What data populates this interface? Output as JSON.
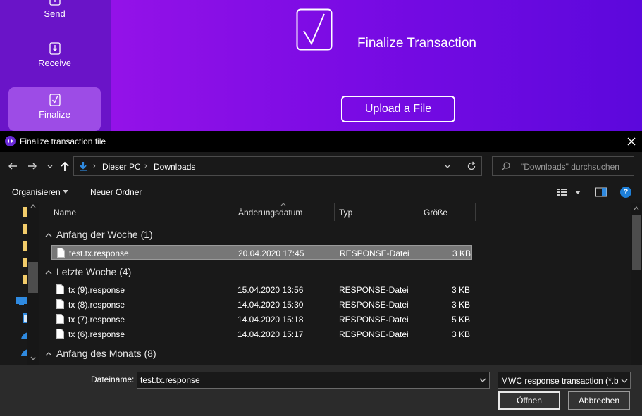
{
  "app": {
    "nav": [
      {
        "label": "Send",
        "icon": "upload-icon"
      },
      {
        "label": "Receive",
        "icon": "download-icon"
      },
      {
        "label": "Finalize",
        "icon": "checkbox-icon"
      }
    ],
    "main": {
      "title": "Finalize Transaction",
      "upload_label": "Upload a File"
    },
    "colors": {
      "sidebar": "#6a14c8",
      "main_start": "#9412e8",
      "main_end": "#5c08dc",
      "active_nav": "#9d4ce6"
    }
  },
  "dialog": {
    "title": "Finalize transaction file",
    "breadcrumb": [
      "Dieser PC",
      "Downloads"
    ],
    "search_placeholder": "\"Downloads\" durchsuchen",
    "toolbar": {
      "organize": "Organisieren",
      "new_folder": "Neuer Ordner"
    },
    "columns": {
      "name": "Name",
      "date": "Änderungsdatum",
      "type": "Typ",
      "size": "Größe"
    },
    "groups": [
      {
        "label": "Anfang der Woche (1)",
        "files": [
          {
            "name": "test.tx.response",
            "date": "20.04.2020 17:45",
            "type": "RESPONSE-Datei",
            "size": "3 KB",
            "selected": true
          }
        ]
      },
      {
        "label": "Letzte Woche (4)",
        "files": [
          {
            "name": "tx (9).response",
            "date": "15.04.2020 13:56",
            "type": "RESPONSE-Datei",
            "size": "3 KB"
          },
          {
            "name": "tx (8).response",
            "date": "14.04.2020 15:30",
            "type": "RESPONSE-Datei",
            "size": "3 KB"
          },
          {
            "name": "tx (7).response",
            "date": "14.04.2020 15:18",
            "type": "RESPONSE-Datei",
            "size": "5 KB"
          },
          {
            "name": "tx (6).response",
            "date": "14.04.2020 15:17",
            "type": "RESPONSE-Datei",
            "size": "3 KB"
          }
        ]
      },
      {
        "label": "Anfang des Monats (8)",
        "files": []
      }
    ],
    "filename_label": "Dateiname:",
    "filename_value": "test.tx.response",
    "filetype_value": "MWC response transaction (*.b",
    "open_label": "Öffnen",
    "cancel_label": "Abbrechen"
  }
}
